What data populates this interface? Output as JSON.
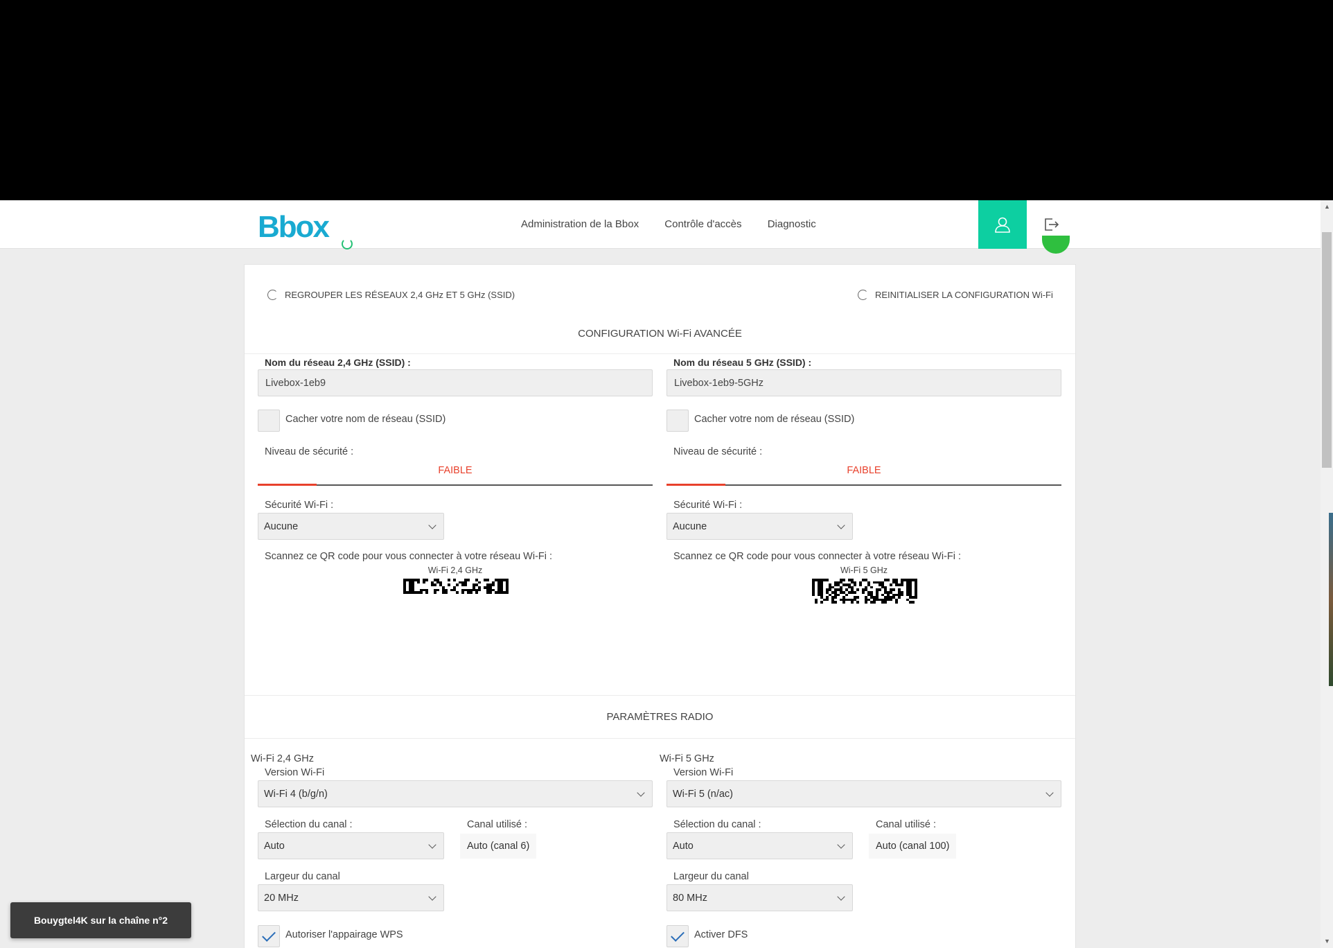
{
  "header": {
    "logo": "Bbox",
    "nav": [
      "Administration de la Bbox",
      "Contrôle d'accès",
      "Diagnostic"
    ]
  },
  "actions": {
    "group_networks": "REGROUPER LES RÉSEAUX 2,4 GHz ET 5 GHz (SSID)",
    "reset_config": "REINITIALISER LA CONFIGURATION Wi-Fi"
  },
  "advanced": {
    "title": "CONFIGURATION Wi-Fi AVANCÉE",
    "band24": {
      "ssid_label": "Nom du réseau 2,4 GHz (SSID) :",
      "ssid_value": "Livebox-1eb9",
      "hide_label": "Cacher votre nom de réseau (SSID)",
      "security_level_label": "Niveau de sécurité :",
      "security_level": "FAIBLE",
      "security_level_fraction": 0.15,
      "wifi_security_label": "Sécurité Wi-Fi :",
      "wifi_security": "Aucune",
      "qr_label": "Scannez ce QR code pour vous connecter à votre réseau Wi-Fi :",
      "qr_caption": "Wi-Fi 2,4 GHz"
    },
    "band5": {
      "ssid_label": "Nom du réseau 5 GHz (SSID) :",
      "ssid_value": "Livebox-1eb9-5GHz",
      "hide_label": "Cacher votre nom de réseau (SSID)",
      "security_level_label": "Niveau de sécurité :",
      "security_level": "FAIBLE",
      "security_level_fraction": 0.15,
      "wifi_security_label": "Sécurité Wi-Fi :",
      "wifi_security": "Aucune",
      "qr_label": "Scannez ce QR code pour vous connecter à votre réseau Wi-Fi :",
      "qr_caption": "Wi-Fi 5 GHz"
    }
  },
  "radio": {
    "title": "PARAMÈTRES RADIO",
    "band24": {
      "heading": "Wi-Fi 2,4 GHz",
      "version_label": "Version Wi-Fi",
      "version": "Wi-Fi 4 (b/g/n)",
      "channel_sel_label": "Sélection du canal :",
      "channel_sel": "Auto",
      "channel_used_label": "Canal utilisé :",
      "channel_used": "Auto (canal 6)",
      "width_label": "Largeur du canal",
      "width": "20 MHz",
      "option_label": "Autoriser l'appairage WPS"
    },
    "band5": {
      "heading": "Wi-Fi 5 GHz",
      "version_label": "Version Wi-Fi",
      "version": "Wi-Fi 5 (n/ac)",
      "channel_sel_label": "Sélection du canal :",
      "channel_sel": "Auto",
      "channel_used_label": "Canal utilisé :",
      "channel_used": "Auto (canal 100)",
      "width_label": "Largeur du canal",
      "width": "80 MHz",
      "option_label": "Activer DFS"
    }
  },
  "toast": "Bouygtel4K sur la chaîne n°2",
  "colors": {
    "accent": "#0dcfa1",
    "brand": "#19aad1",
    "danger": "#e8412c"
  }
}
